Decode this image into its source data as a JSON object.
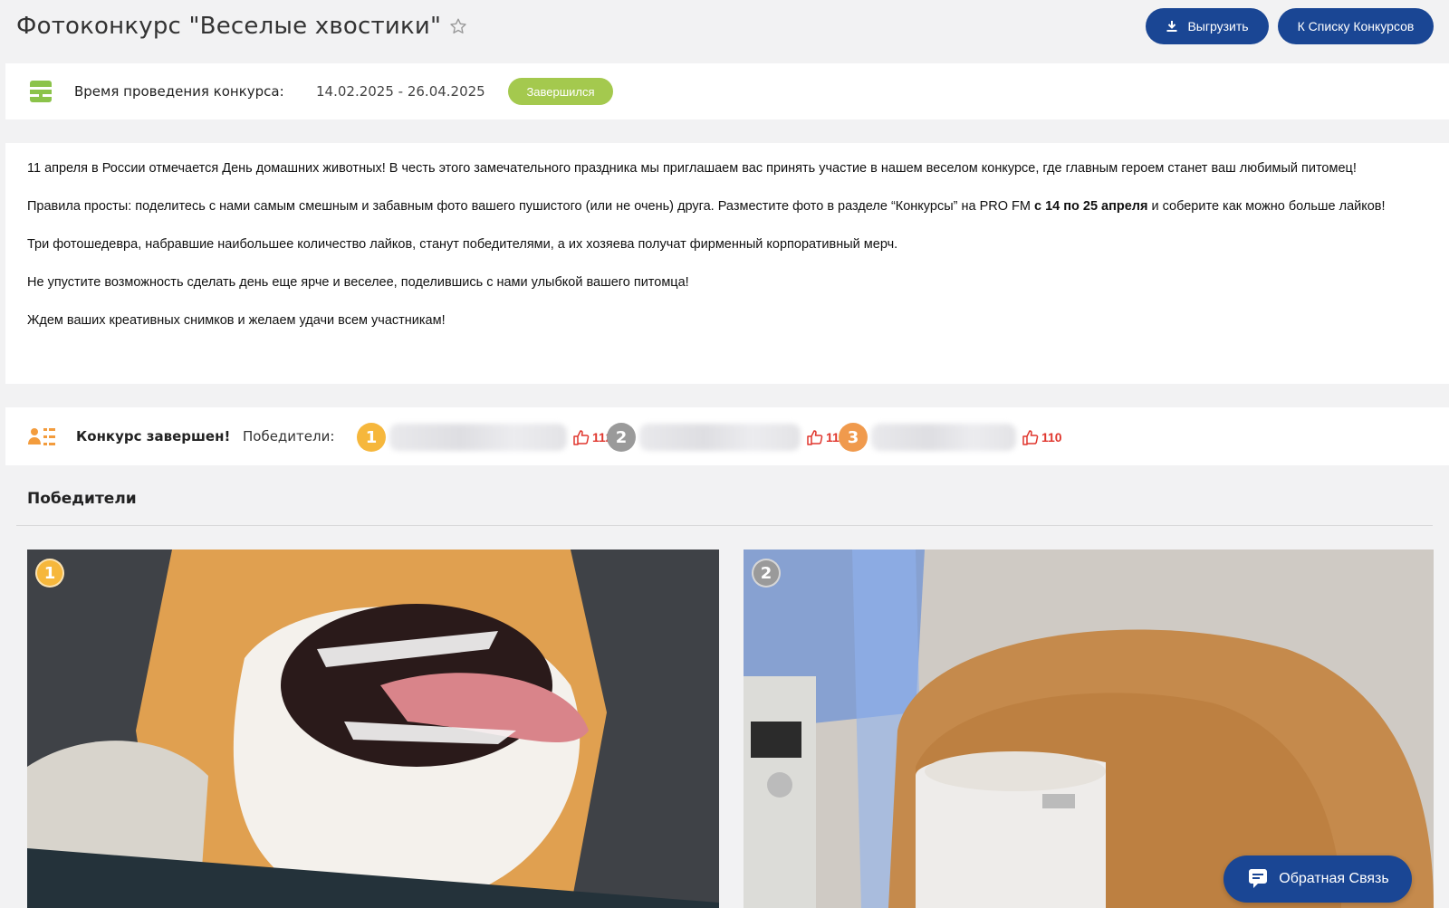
{
  "header": {
    "title": "Фотоконкурс \"Веселые хвостики\"",
    "export_label": "Выгрузить",
    "back_label": "К Списку Конкурсов"
  },
  "dates": {
    "label": "Время проведения конкурса:",
    "value": "14.02.2025 - 26.04.2025",
    "status": "Завершился",
    "status_color": "#a4c94e"
  },
  "description": {
    "p1": "11 апреля в России отмечается День домашних животных! В честь этого замечательного праздника мы приглашаем вас принять участие в нашем веселом конкурсе, где главным героем станет ваш любимый питомец!",
    "p2_start": "Правила просты: поделитесь с нами самым смешным и забавным фото вашего пушистого (или не очень) друга. Разместите фото в разделе “Конкурсы” на PRO FM ",
    "p2_bold": "с 14 по 25 апреля",
    "p2_end": " и соберите как можно больше лайков!",
    "p3": "Три фотошедевра, набравшие наибольшее количество лайков, станут победителями, а их хозяева получат фирменный корпоративный мерч.",
    "p4": "Не упустите возможность сделать день еще ярче и веселее, поделившись с нами улыбкой вашего питомца!",
    "p5": "Ждем ваших креативных снимков и желаем удачи всем участникам!"
  },
  "result": {
    "title": "Конкурс завершен!",
    "winners_label": "Победители:",
    "winners": [
      {
        "place": "1",
        "likes": "112"
      },
      {
        "place": "2",
        "likes": "111"
      },
      {
        "place": "3",
        "likes": "110"
      }
    ]
  },
  "winners_section": {
    "title": "Победители",
    "photos": [
      {
        "place": "1",
        "icon": "dog-photo"
      },
      {
        "place": "2",
        "icon": "cat-photo"
      }
    ]
  },
  "feedback": {
    "label": "Обратная Связь"
  },
  "colors": {
    "brand": "#1a4694",
    "like": "#e0372e",
    "gold": "#f6b73c",
    "silver": "#9a9a9a",
    "bronze": "#f09a4d"
  }
}
